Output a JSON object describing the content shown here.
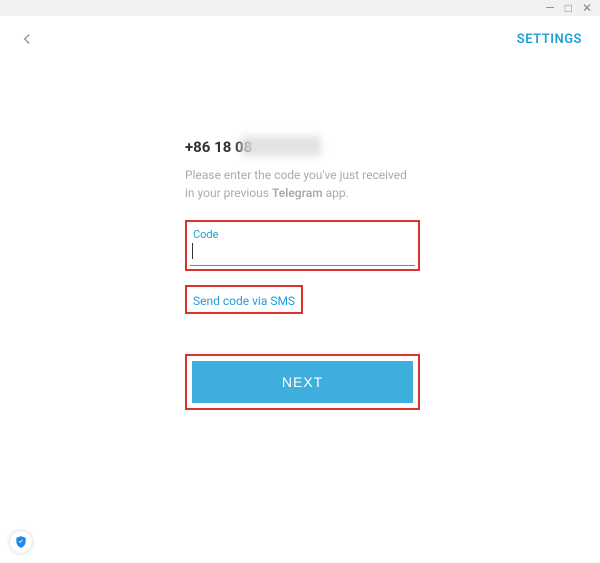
{
  "window": {
    "minimize": "—",
    "maximize": "□",
    "close": "✕"
  },
  "header": {
    "settings_label": "SETTINGS"
  },
  "verify": {
    "phone": "+86 18            08",
    "instruction_line1": "Please enter the code you've just received",
    "instruction_line2_pre": "in your previous ",
    "instruction_line2_app": "Telegram",
    "instruction_line2_post": " app.",
    "code_label": "Code",
    "code_value": "",
    "sms_link": "Send code via SMS",
    "next_label": "NEXT"
  },
  "colors": {
    "accent": "#1e9fd6",
    "highlight": "#d9332b",
    "button": "#3eaedd"
  }
}
